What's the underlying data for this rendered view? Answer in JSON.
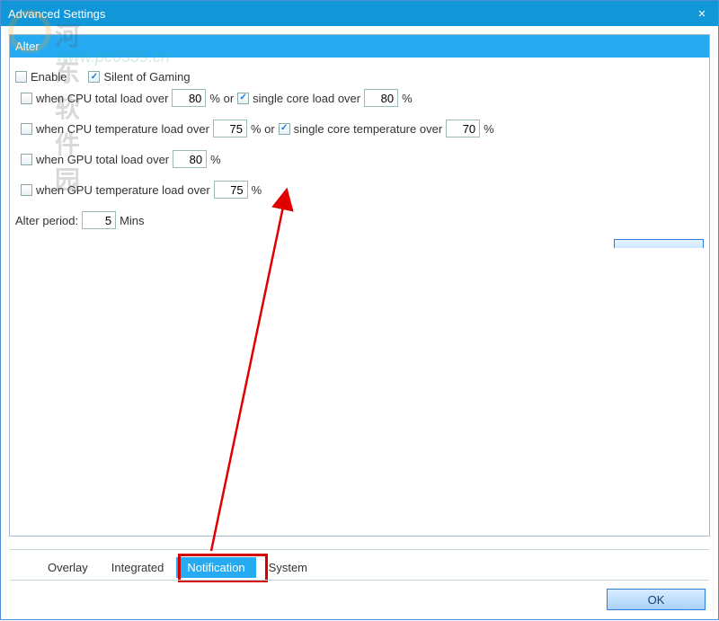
{
  "window": {
    "title": "Advanced Settings"
  },
  "panel": {
    "header_label": "Alter"
  },
  "top": {
    "enable_label": "Enable",
    "silent_label": "Silent of Gaming",
    "enable_checked": false,
    "silent_checked": true
  },
  "rules": {
    "cpu_total": {
      "label": "when CPU total load over",
      "value": "80",
      "unit": "% or",
      "single_label": "single core load over",
      "single_value": "80",
      "single_unit": "%",
      "checked": false,
      "single_checked": true
    },
    "cpu_temp": {
      "label": "when CPU temperature load over",
      "value": "75",
      "unit": "% or",
      "single_label": "single core temperature over",
      "single_value": "70",
      "single_unit": "%",
      "checked": false,
      "single_checked": true
    },
    "gpu_total": {
      "label": "when GPU total load over",
      "value": "80",
      "unit": "%",
      "checked": false
    },
    "gpu_temp": {
      "label": "when GPU temperature load over",
      "value": "75",
      "unit": "%",
      "checked": false
    }
  },
  "period": {
    "label": "Alter period:",
    "value": "5",
    "unit": "Mins"
  },
  "tabs": {
    "overlay": "Overlay",
    "integrated": "Integrated",
    "notification": "Notification",
    "system": "System"
  },
  "buttons": {
    "ok": "OK"
  },
  "watermark": {
    "text1": "河东软件园",
    "text2": "www.pc0359.cn"
  }
}
